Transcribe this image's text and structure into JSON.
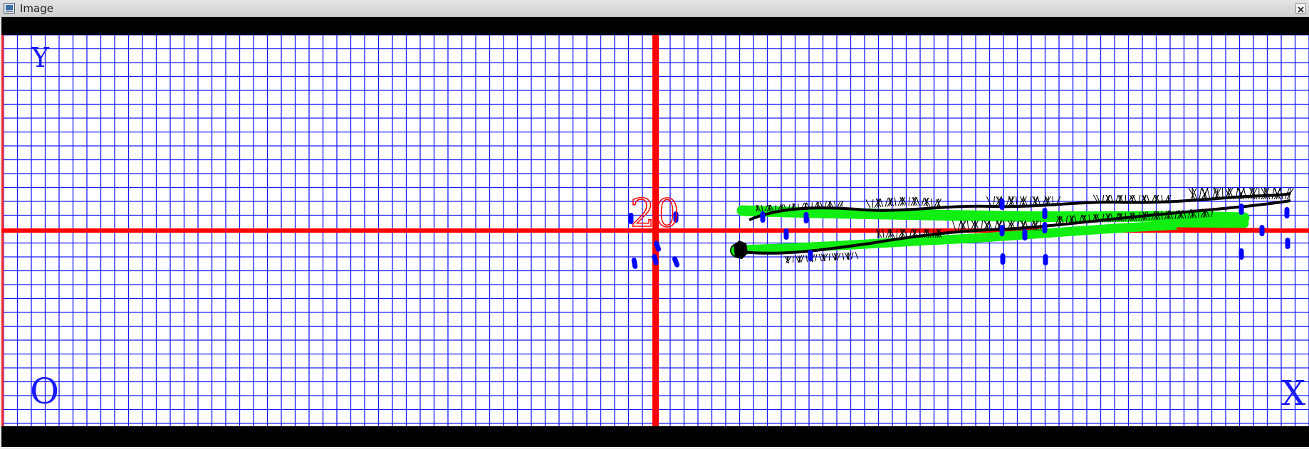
{
  "window": {
    "title": "Image",
    "icons": {
      "app": "image-window-icon",
      "close": "close-icon"
    }
  },
  "viewer": {
    "axis_labels": {
      "y": "Y",
      "origin": "O",
      "x": "X"
    },
    "marker_label": "20",
    "colors": {
      "background": "#ffffff",
      "grid": "#1a1aff",
      "axis": "#ff0000",
      "band": "#000000",
      "path_green": "#11ee11",
      "path_black": "#000000",
      "points": "#0000ff",
      "labels_axis": "#1a1aff",
      "label_marker": "#ff0000"
    }
  }
}
